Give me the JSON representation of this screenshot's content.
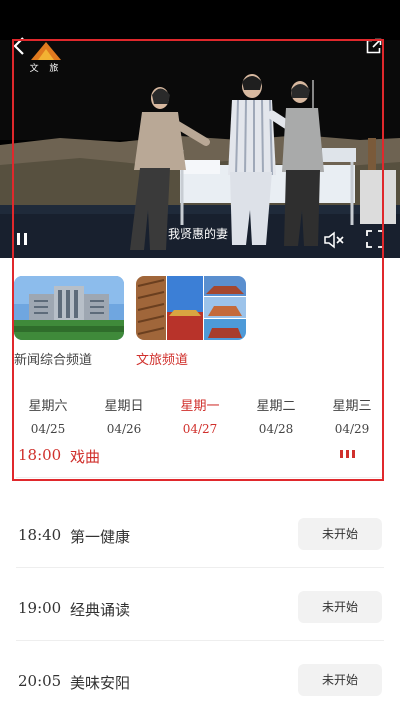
{
  "player": {
    "logo_text": "文 旅",
    "subtitle": "我贤惠的妻"
  },
  "channels": [
    {
      "label": "新闻综合频道",
      "active": false
    },
    {
      "label": "文旅频道",
      "active": true
    }
  ],
  "week": [
    {
      "weekday": "星期六",
      "date": "04/25",
      "active": false
    },
    {
      "weekday": "星期日",
      "date": "04/26",
      "active": false
    },
    {
      "weekday": "星期一",
      "date": "04/27",
      "active": true
    },
    {
      "weekday": "星期二",
      "date": "04/28",
      "active": false
    },
    {
      "weekday": "星期三",
      "date": "04/29",
      "active": false
    }
  ],
  "schedule": {
    "current": {
      "time": "18:00",
      "title": "戏曲"
    },
    "items": [
      {
        "time": "18:40",
        "title": "第一健康",
        "status": "未开始"
      },
      {
        "time": "19:00",
        "title": "经典诵读",
        "status": "未开始"
      },
      {
        "time": "20:05",
        "title": "美味安阳",
        "status": "未开始"
      }
    ]
  },
  "colors": {
    "accent": "#d0302c",
    "highlight": "#e0282c"
  }
}
